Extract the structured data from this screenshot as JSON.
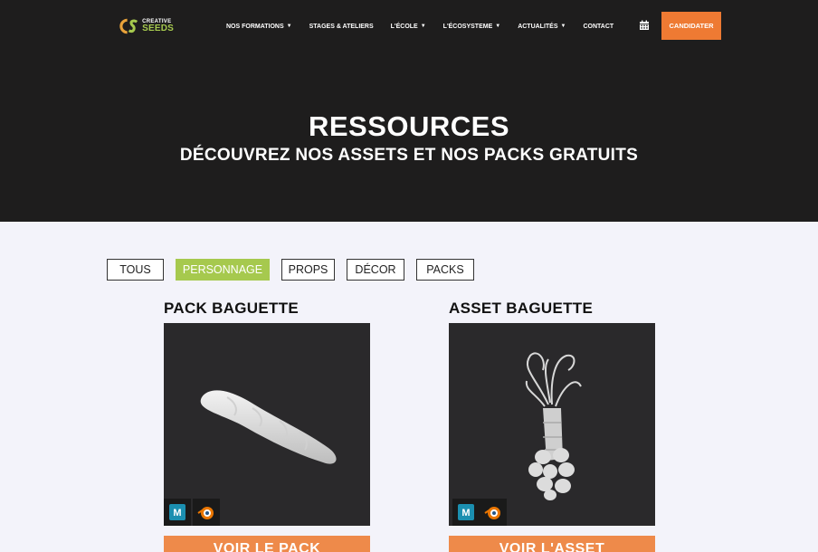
{
  "header": {
    "logo": {
      "line1": "CREATIVE",
      "line2": "SEEDS"
    },
    "nav": [
      {
        "label": "NOS FORMATIONS",
        "dropdown": true
      },
      {
        "label": "STAGES & ATELIERS",
        "dropdown": false
      },
      {
        "label": "L'ÉCOLE",
        "dropdown": true
      },
      {
        "label": "L'ÉCOSYSTEME",
        "dropdown": true
      },
      {
        "label": "ACTUALITÉS",
        "dropdown": true
      },
      {
        "label": "CONTACT",
        "dropdown": false
      }
    ],
    "calendar_icon": "calendar-icon",
    "cta_label": "CANDIDATER"
  },
  "hero": {
    "title": "RESSOURCES",
    "subtitle": "DÉCOUVREZ NOS ASSETS ET NOS PACKS GRATUITS"
  },
  "filters": [
    {
      "label": "TOUS",
      "active": false
    },
    {
      "label": "PERSONNAGE",
      "active": true
    },
    {
      "label": "PROPS",
      "active": false
    },
    {
      "label": "DÉCOR",
      "active": false
    },
    {
      "label": "PACKS",
      "active": false
    }
  ],
  "cards": [
    {
      "title": "PACK BAGUETTE",
      "button": "VOIR LE PACK",
      "software": [
        "maya-icon",
        "blender-icon"
      ]
    },
    {
      "title": "ASSET BAGUETTE",
      "button": "VOIR L'ASSET",
      "software": [
        "maya-icon",
        "blender-icon"
      ]
    }
  ],
  "colors": {
    "accent_orange": "#ee7a33",
    "accent_green": "#a6c94e",
    "header_bg": "#1e1d1d",
    "page_bg": "#f3f3fa"
  }
}
